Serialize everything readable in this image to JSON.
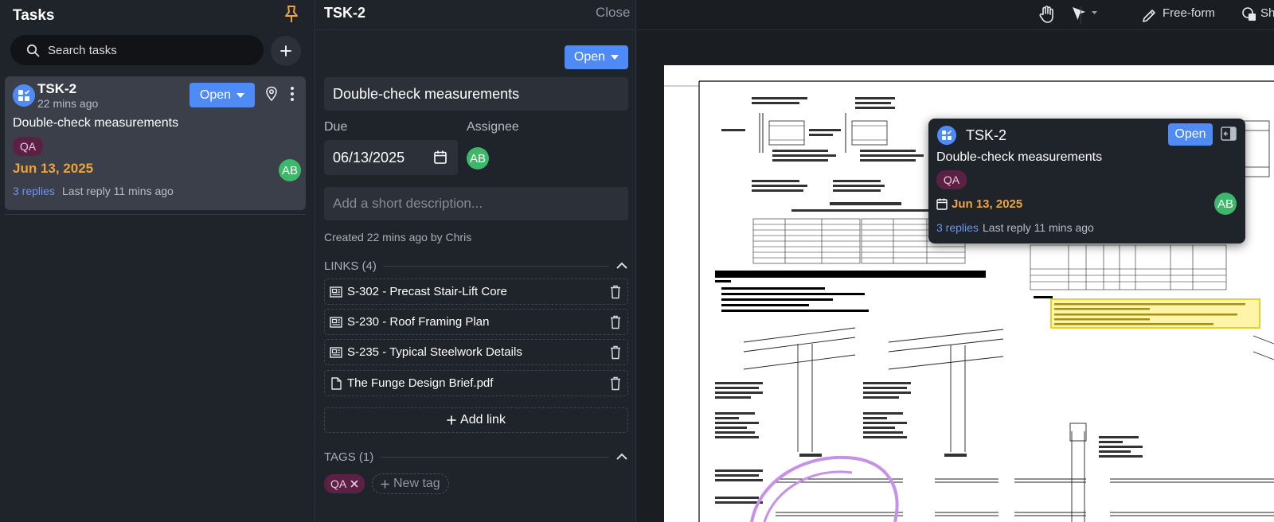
{
  "tasks_panel": {
    "title": "Tasks",
    "search_placeholder": "Search tasks",
    "task": {
      "id": "TSK-2",
      "time_ago": "22 mins ago",
      "status": "Open",
      "name": "Double-check measurements",
      "tag": "QA",
      "due": "Jun 13, 2025",
      "assignee_initials": "AB",
      "replies": "3 replies",
      "last_reply": "Last reply 11 mins ago"
    }
  },
  "detail": {
    "title": "TSK-2",
    "close_label": "Close",
    "status": "Open",
    "task_title": "Double-check measurements",
    "due_label": "Due",
    "due_value": "06/13/2025",
    "assignee_label": "Assignee",
    "assignee_initials": "AB",
    "description_placeholder": "Add a short description...",
    "created": "Created 22 mins ago by Chris",
    "links_heading": "LINKS (4)",
    "links": [
      {
        "label": "S-302 - Precast Stair-Lift Core",
        "icon": "drawing-icon"
      },
      {
        "label": "S-230 - Roof Framing Plan",
        "icon": "drawing-icon"
      },
      {
        "label": "S-235 - Typical Steelwork Details",
        "icon": "drawing-icon"
      },
      {
        "label": "The Funge Design Brief.pdf",
        "icon": "file-icon"
      }
    ],
    "add_link_label": "Add link",
    "tags_heading": "TAGS (1)",
    "tag": "QA",
    "new_tag_label": "New tag"
  },
  "toolbar": {
    "freeform_label": "Free-form",
    "shapes_label": "Sh"
  },
  "tooltip": {
    "id": "TSK-2",
    "status": "Open",
    "name": "Double-check measurements",
    "tag": "QA",
    "due": "Jun 13, 2025",
    "assignee_initials": "AB",
    "replies": "3 replies",
    "last_reply": "Last reply 11 mins ago"
  },
  "colors": {
    "accent": "#4f8bf7",
    "due": "#f0a23c",
    "tag_bg": "#5a2145",
    "avatar": "#3db86a"
  }
}
